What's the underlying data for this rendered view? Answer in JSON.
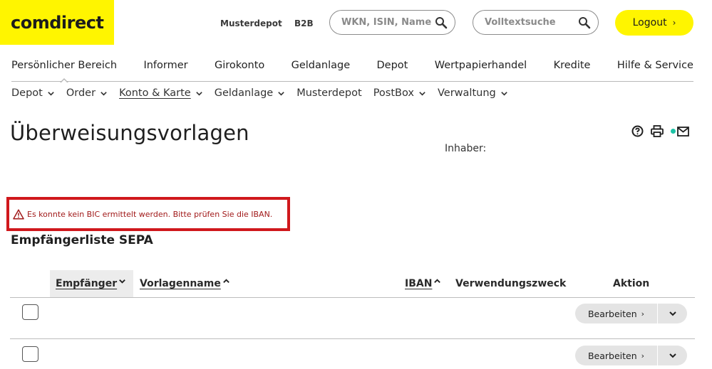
{
  "header": {
    "logo": "comdirect",
    "links": [
      "Musterdepot",
      "B2B"
    ],
    "search1_placeholder": "WKN, ISIN, Name",
    "search2_placeholder": "Volltextsuche",
    "logout_label": "Logout",
    "logout_chevron": "›",
    "accent_color": "#fff500"
  },
  "main_nav": [
    "Persönlicher Bereich",
    "Informer",
    "Girokonto",
    "Geldanlage",
    "Depot",
    "Wertpapierhandel",
    "Kredite",
    "Hilfe & Service"
  ],
  "sub_nav": [
    {
      "label": "Depot",
      "dropdown": true
    },
    {
      "label": "Order",
      "dropdown": true
    },
    {
      "label": "Konto & Karte",
      "dropdown": true
    },
    {
      "label": "Geldanlage",
      "dropdown": true
    },
    {
      "label": "Musterdepot",
      "dropdown": false
    },
    {
      "label": "PostBox",
      "dropdown": true
    },
    {
      "label": "Verwaltung",
      "dropdown": true
    }
  ],
  "page": {
    "title": "Überweisungsvorlagen",
    "owner_label": "Inhaber:",
    "status_dot_color": "#1dc3a6"
  },
  "error": {
    "message": "Es konnte kein BIC ermittelt werden. Bitte prüfen Sie die IBAN.",
    "color": "#d0181c"
  },
  "section_title": "Empfängerliste SEPA",
  "table": {
    "columns": [
      "Empfänger",
      "Vorlagenname",
      "IBAN",
      "Verwendungszweck",
      "Aktion"
    ],
    "rows": [
      {
        "edit_label": "Bearbeiten",
        "edit_chevron": "›"
      },
      {
        "edit_label": "Bearbeiten",
        "edit_chevron": "›"
      }
    ]
  }
}
